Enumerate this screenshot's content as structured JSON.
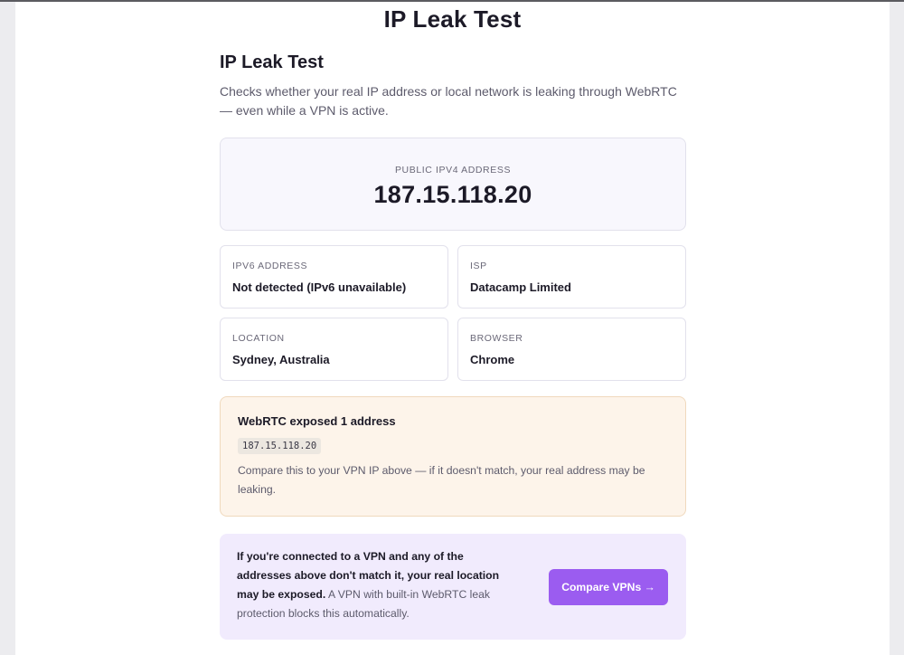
{
  "page": {
    "title": "IP Leak Test"
  },
  "section": {
    "title": "IP Leak Test",
    "description": "Checks whether your real IP address or local network is leaking through WebRTC — even while a VPN is active."
  },
  "public_ipv4": {
    "label": "PUBLIC IPV4 ADDRESS",
    "value": "187.15.118.20"
  },
  "info": [
    {
      "label": "IPV6 ADDRESS",
      "value": "Not detected (IPv6 unavailable)"
    },
    {
      "label": "ISP",
      "value": "Datacamp Limited"
    },
    {
      "label": "LOCATION",
      "value": "Sydney, Australia"
    },
    {
      "label": "BROWSER",
      "value": "Chrome"
    }
  ],
  "webrtc": {
    "heading": "WebRTC exposed 1 address",
    "addresses": [
      "187.15.118.20"
    ],
    "note": "Compare this to your VPN IP above — if it doesn't match, your real address may be leaking."
  },
  "cta": {
    "bold_text": "If you're connected to a VPN and any of the addresses above don't match it, your real location may be exposed.",
    "text": " A VPN with built-in WebRTC leak protection blocks this automatically.",
    "button_label": "Compare VPNs →"
  },
  "colors": {
    "accent": "#9b5cf0",
    "cta_background": "#f1ebfd",
    "warning_background": "#fdf4ea",
    "warning_border": "#f0d9bd"
  }
}
